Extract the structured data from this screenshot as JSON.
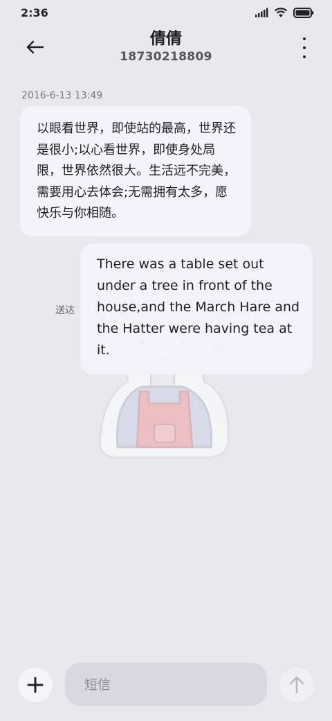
{
  "status_bar": {
    "time": "2:36",
    "icons": [
      "signal-icon",
      "wifi-icon",
      "battery-icon"
    ]
  },
  "header": {
    "contact_name": "倩倩",
    "phone_number": "18730218809"
  },
  "conversation": {
    "timestamp": "2016-6-13 13:49",
    "messages": [
      {
        "direction": "incoming",
        "text": "以眼看世界，即使站的最高，世界还是很小;以心看世界，即使身处局限，世界依然很大。生活远不完美，需要用心去体会;无需拥有太多，愿快乐与你相随。"
      },
      {
        "direction": "outgoing",
        "text": "There was a table set out under a tree in front of the house,and the March Hare and the Hatter were having tea at it.",
        "status": "送达"
      }
    ]
  },
  "composer": {
    "placeholder": "短信",
    "value": ""
  },
  "colors": {
    "background": "#e6e9ee",
    "bubble": "#f1f4fb",
    "input_bg": "#d6d9df"
  }
}
